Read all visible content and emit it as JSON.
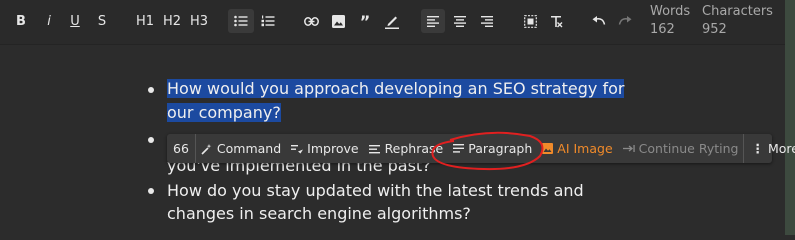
{
  "toolbar": {
    "bold": "B",
    "italic": "i",
    "underline": "U",
    "strike": "S",
    "h1": "H1",
    "h2": "H2",
    "h3": "H3",
    "words_label": "Words",
    "words_value": "162",
    "chars_label": "Characters",
    "chars_value": "952"
  },
  "document": {
    "items": [
      {
        "lines": [
          "How would you approach developing an SEO strategy for",
          "our company?"
        ],
        "selected": true
      },
      {
        "lines": [
          "you've implemented in the past?"
        ]
      },
      {
        "lines": [
          "How do you stay updated with the latest trends and",
          "changes in search engine algorithms?"
        ]
      }
    ]
  },
  "popup": {
    "count": "66",
    "command": "Command",
    "improve": "Improve",
    "rephrase": "Rephrase",
    "paragraph": "Paragraph",
    "ai_image": "AI Image",
    "continue": "Continue Ryting",
    "more": "More"
  },
  "colors": {
    "background": "#2c2c2c",
    "selection": "#1c4aa0",
    "ai_image": "#f08a2a",
    "annotation": "#e02020"
  }
}
